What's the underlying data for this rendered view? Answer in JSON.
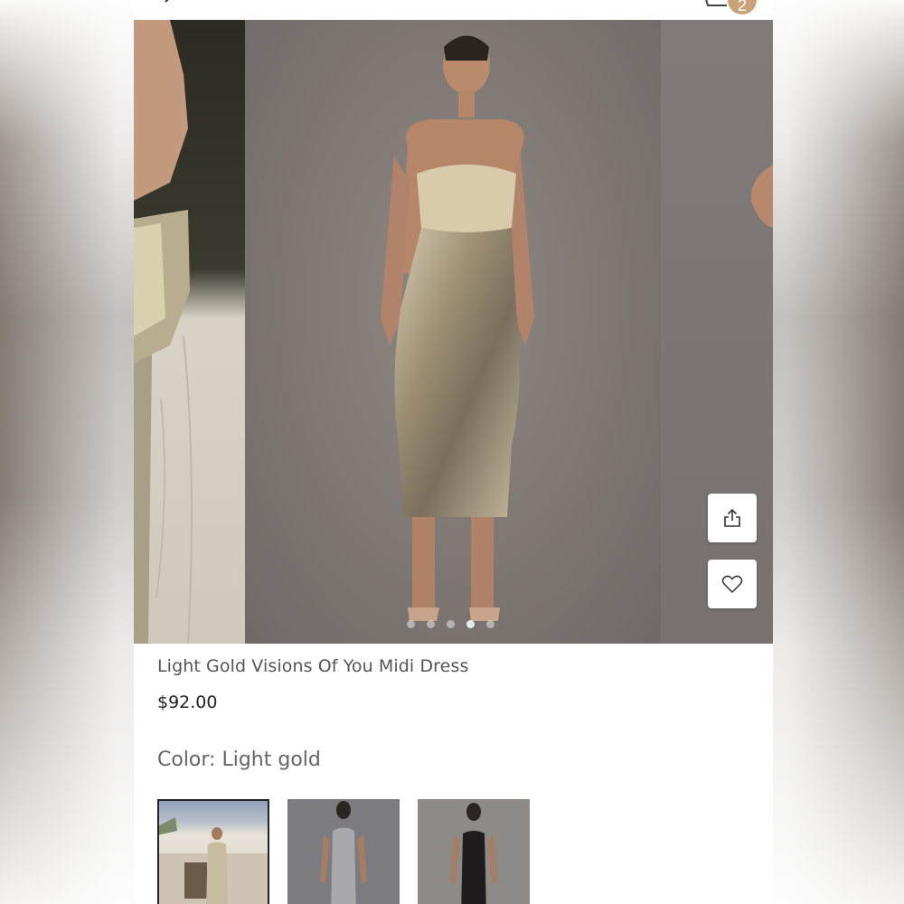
{
  "header": {
    "back_icon": "chevron-left-icon",
    "cart_icon": "cart-icon",
    "cart_count": "2",
    "accent_color": "#c9a27c"
  },
  "gallery": {
    "slide_count": 5,
    "active_slide": 4,
    "share_icon": "share-icon",
    "favorite_icon": "heart-icon"
  },
  "product": {
    "title": "Light Gold Visions Of You Midi Dress",
    "price": "$92.00",
    "color_label": "Color:",
    "color_value": "Light gold",
    "color_options": [
      {
        "name": "Light gold",
        "selected": true
      },
      {
        "name": "Silver",
        "selected": false
      },
      {
        "name": "Black",
        "selected": false
      }
    ]
  }
}
